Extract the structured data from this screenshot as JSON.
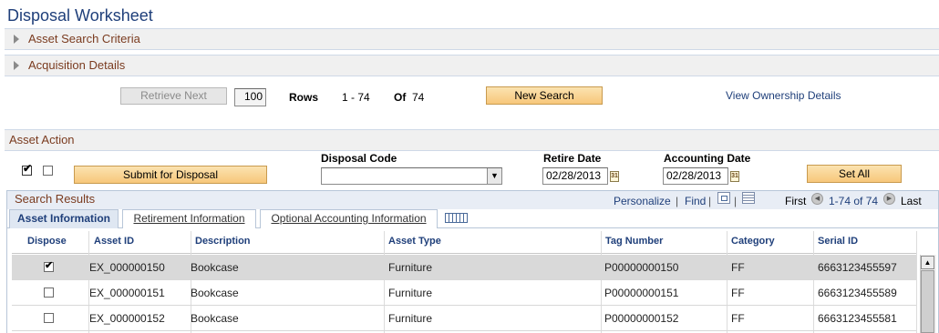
{
  "page": {
    "title": "Disposal Worksheet"
  },
  "sections": {
    "asset_search_criteria": "Asset Search Criteria",
    "acquisition_details": "Acquisition Details",
    "asset_action": "Asset Action"
  },
  "paging": {
    "retrieve_next": "Retrieve Next",
    "rows_value": "100",
    "rows_label": "Rows",
    "range": "1 - 74",
    "of_label": "Of",
    "total": "74",
    "new_search": "New Search",
    "view_ownership": "View Ownership Details"
  },
  "asset_action": {
    "select_all_checked": true,
    "submit_label": "Submit for Disposal",
    "disposal_code_label": "Disposal Code",
    "disposal_code_value": "",
    "retire_date_label": "Retire Date",
    "retire_date_value": "02/28/2013",
    "accounting_date_label": "Accounting Date",
    "accounting_date_value": "02/28/2013",
    "set_all_label": "Set All"
  },
  "results": {
    "title": "Search Results",
    "personalize": "Personalize",
    "sep": "|",
    "find": "Find",
    "first": "First",
    "range": "1-74 of 74",
    "last": "Last",
    "tabs": [
      "Asset Information",
      "Retirement Information",
      "Optional Accounting Information"
    ],
    "columns": [
      "Dispose",
      "Asset ID",
      "Description",
      "Asset Type",
      "Tag Number",
      "Category",
      "Serial ID"
    ],
    "rows": [
      {
        "checked": true,
        "asset_id": "EX_000000150",
        "description": "Bookcase",
        "asset_type": "Furniture",
        "tag": "P00000000150",
        "category": "FF",
        "serial": "6663123455597"
      },
      {
        "checked": false,
        "asset_id": "EX_000000151",
        "description": "Bookcase",
        "asset_type": "Furniture",
        "tag": "P00000000151",
        "category": "FF",
        "serial": "6663123455589"
      },
      {
        "checked": false,
        "asset_id": "EX_000000152",
        "description": "Bookcase",
        "asset_type": "Furniture",
        "tag": "P00000000152",
        "category": "FF",
        "serial": "6663123455581"
      }
    ]
  },
  "icons": {
    "expand": "triangle-right-icon",
    "calendar": "calendar-icon",
    "dropdown": "chevron-down-icon",
    "download": "download-icon",
    "grid_view": "grid-view-icon",
    "show_all_cols": "show-all-columns-icon",
    "prev": "previous-icon",
    "next": "next-icon",
    "scroll_up": "scroll-up-icon"
  },
  "colors": {
    "title": "#1f3f7a",
    "section_text": "#7a3b1f",
    "selected_row": "#d9d9d9",
    "button_orange": "#f7c77a"
  }
}
